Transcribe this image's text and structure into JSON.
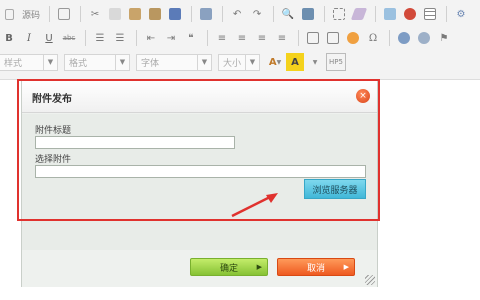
{
  "toolbar": {
    "row1": {
      "source_label": "源码",
      "icons": [
        "separator-handle-icon",
        "doc-icon",
        "source-icon",
        "new-page-icon",
        "copy-icon",
        "paste-icon",
        "paste-text-icon",
        "paste-word-icon",
        "print-icon",
        "undo-icon",
        "redo-icon",
        "find-icon",
        "replace-icon",
        "select-all-icon",
        "eraser-icon",
        "image-icon",
        "flash-icon",
        "table-icon",
        "settings-icon"
      ]
    },
    "row2": {
      "bold": "B",
      "italic": "I",
      "underline": "U",
      "strike": "abc",
      "quote": "❝"
    },
    "row3": {
      "style_value": "样式",
      "format_value": "格式",
      "font_value": "字体",
      "size_value": "大小",
      "font_color": "A",
      "bg_color": "A",
      "html5_label": "HP5"
    }
  },
  "dialog": {
    "title": "附件发布",
    "close_symbol": "×",
    "attachment_title_label": "附件标题",
    "attachment_title_value": "",
    "select_attachment_label": "选择附件",
    "select_attachment_value": "",
    "browse_button": "浏览服务器",
    "ok_button": "确定",
    "cancel_button": "取消",
    "arrow_glyph": "▶"
  },
  "colors": {
    "annotation": "#e0322e",
    "ok_green": "#86c234",
    "cancel_orange": "#ee5a20",
    "browse_cyan": "#41b7d8"
  }
}
